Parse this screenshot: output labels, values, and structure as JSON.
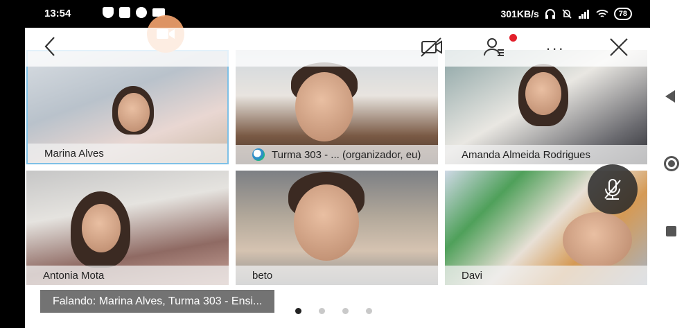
{
  "status_bar": {
    "time": "13:54",
    "speed": "301KB/s",
    "battery": "78",
    "icons": [
      "shield-icon",
      "app-icon",
      "sync-icon",
      "camera-icon",
      "headset-icon",
      "mute-bell-icon",
      "signal-icon",
      "wifi-icon"
    ]
  },
  "toolbar": {
    "icons": [
      "back-icon",
      "record-icon",
      "video-off-icon",
      "participants-icon",
      "more-icon",
      "close-icon"
    ],
    "more_label": "..."
  },
  "participants": [
    {
      "name": "Marina Alves",
      "active": true
    },
    {
      "name": "Turma 303 - ... (organizador, eu)",
      "active": false
    },
    {
      "name": "Amanda Almeida Rodrigues",
      "active": false
    },
    {
      "name": "Antonia Mota",
      "active": false
    },
    {
      "name": "beto",
      "active": false
    },
    {
      "name": "Davi",
      "active": false
    }
  ],
  "speaking": "Falando: Marina Alves, Turma 303 - Ensi...",
  "pager": {
    "pages": 4,
    "current": 1
  },
  "colors": {
    "accent": "#f6a56f",
    "active_border": "#7ec0e6",
    "badge": "#e21f2b"
  }
}
